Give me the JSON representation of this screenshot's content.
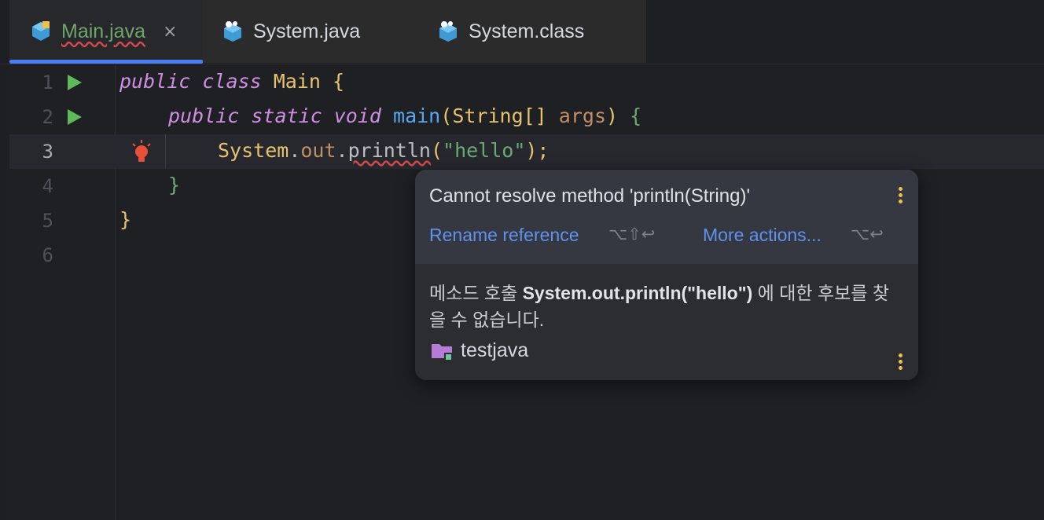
{
  "tabs": [
    {
      "label": "Main.java",
      "active": true,
      "icon": "java-class-icon"
    },
    {
      "label": "System.java",
      "active": false,
      "icon": "java-source-icon"
    },
    {
      "label": "System.class",
      "active": false,
      "icon": "java-classfile-icon"
    }
  ],
  "tab_close": "×",
  "line_numbers": [
    "1",
    "2",
    "3",
    "4",
    "5",
    "6"
  ],
  "code": {
    "l1": {
      "public": "public",
      "class": "class",
      "name": "Main",
      "brace": "{"
    },
    "l2": {
      "public": "public",
      "static": "static",
      "void": "void",
      "main": "main",
      "open": "(",
      "type": "String[]",
      "arg": "args",
      "close": ")",
      "brace": "{"
    },
    "l3": {
      "system": "System",
      "dot1": ".",
      "out": "out",
      "dot2": ".",
      "println": "println",
      "open": "(",
      "str": "\"hello\"",
      "close": ");"
    },
    "l4": {
      "brace": "}"
    },
    "l5": {
      "brace": "}"
    }
  },
  "popup": {
    "message": "Cannot resolve method 'println(String)'",
    "action1": "Rename reference",
    "action1_shortcut": "⌥⇧↩",
    "action2": "More actions...",
    "action2_shortcut": "⌥↩",
    "desc_prefix": "메소드 호출 ",
    "desc_bold": "System.out.println(\"hello\")",
    "desc_suffix": " 에 대한 후보를 찾을 수 없습니다.",
    "module": "testjava"
  },
  "colors": {
    "accent": "#4a7cf2",
    "error": "#d44a4a",
    "run": "#5fb85a",
    "bulb": "#e8503a"
  }
}
